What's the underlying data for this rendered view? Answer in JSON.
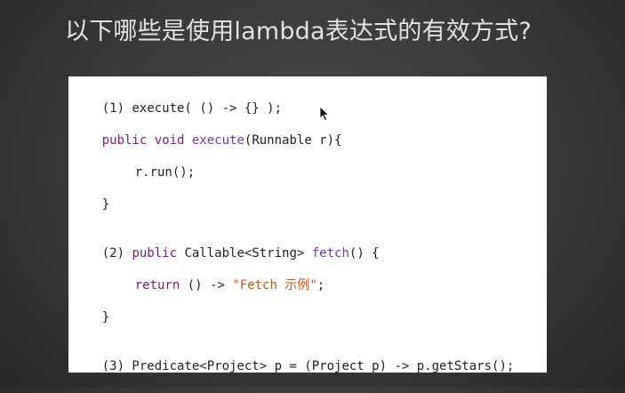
{
  "title": "以下哪些是使用lambda表达式的有效方式?",
  "code": {
    "line1": {
      "text": "(1) execute( () -> {} );"
    },
    "line2": {
      "kw": "public void",
      "space1": " ",
      "fn": "execute",
      "rest": "(Runnable r){"
    },
    "line3": {
      "text": "r.run();"
    },
    "line4": {
      "text": "}"
    },
    "line5": {
      "prefix": "(2) ",
      "kw": "public",
      "mid": " Callable<String> ",
      "fn": "fetch",
      "rest": "() {"
    },
    "line6": {
      "kw": "return",
      "mid": " () -> ",
      "str": "\"Fetch 示例\"",
      "rest": ";"
    },
    "line7": {
      "text": "}"
    },
    "line8": {
      "text": "(3) Predicate<Project> p = (Project p) -> p.getStars();"
    }
  }
}
